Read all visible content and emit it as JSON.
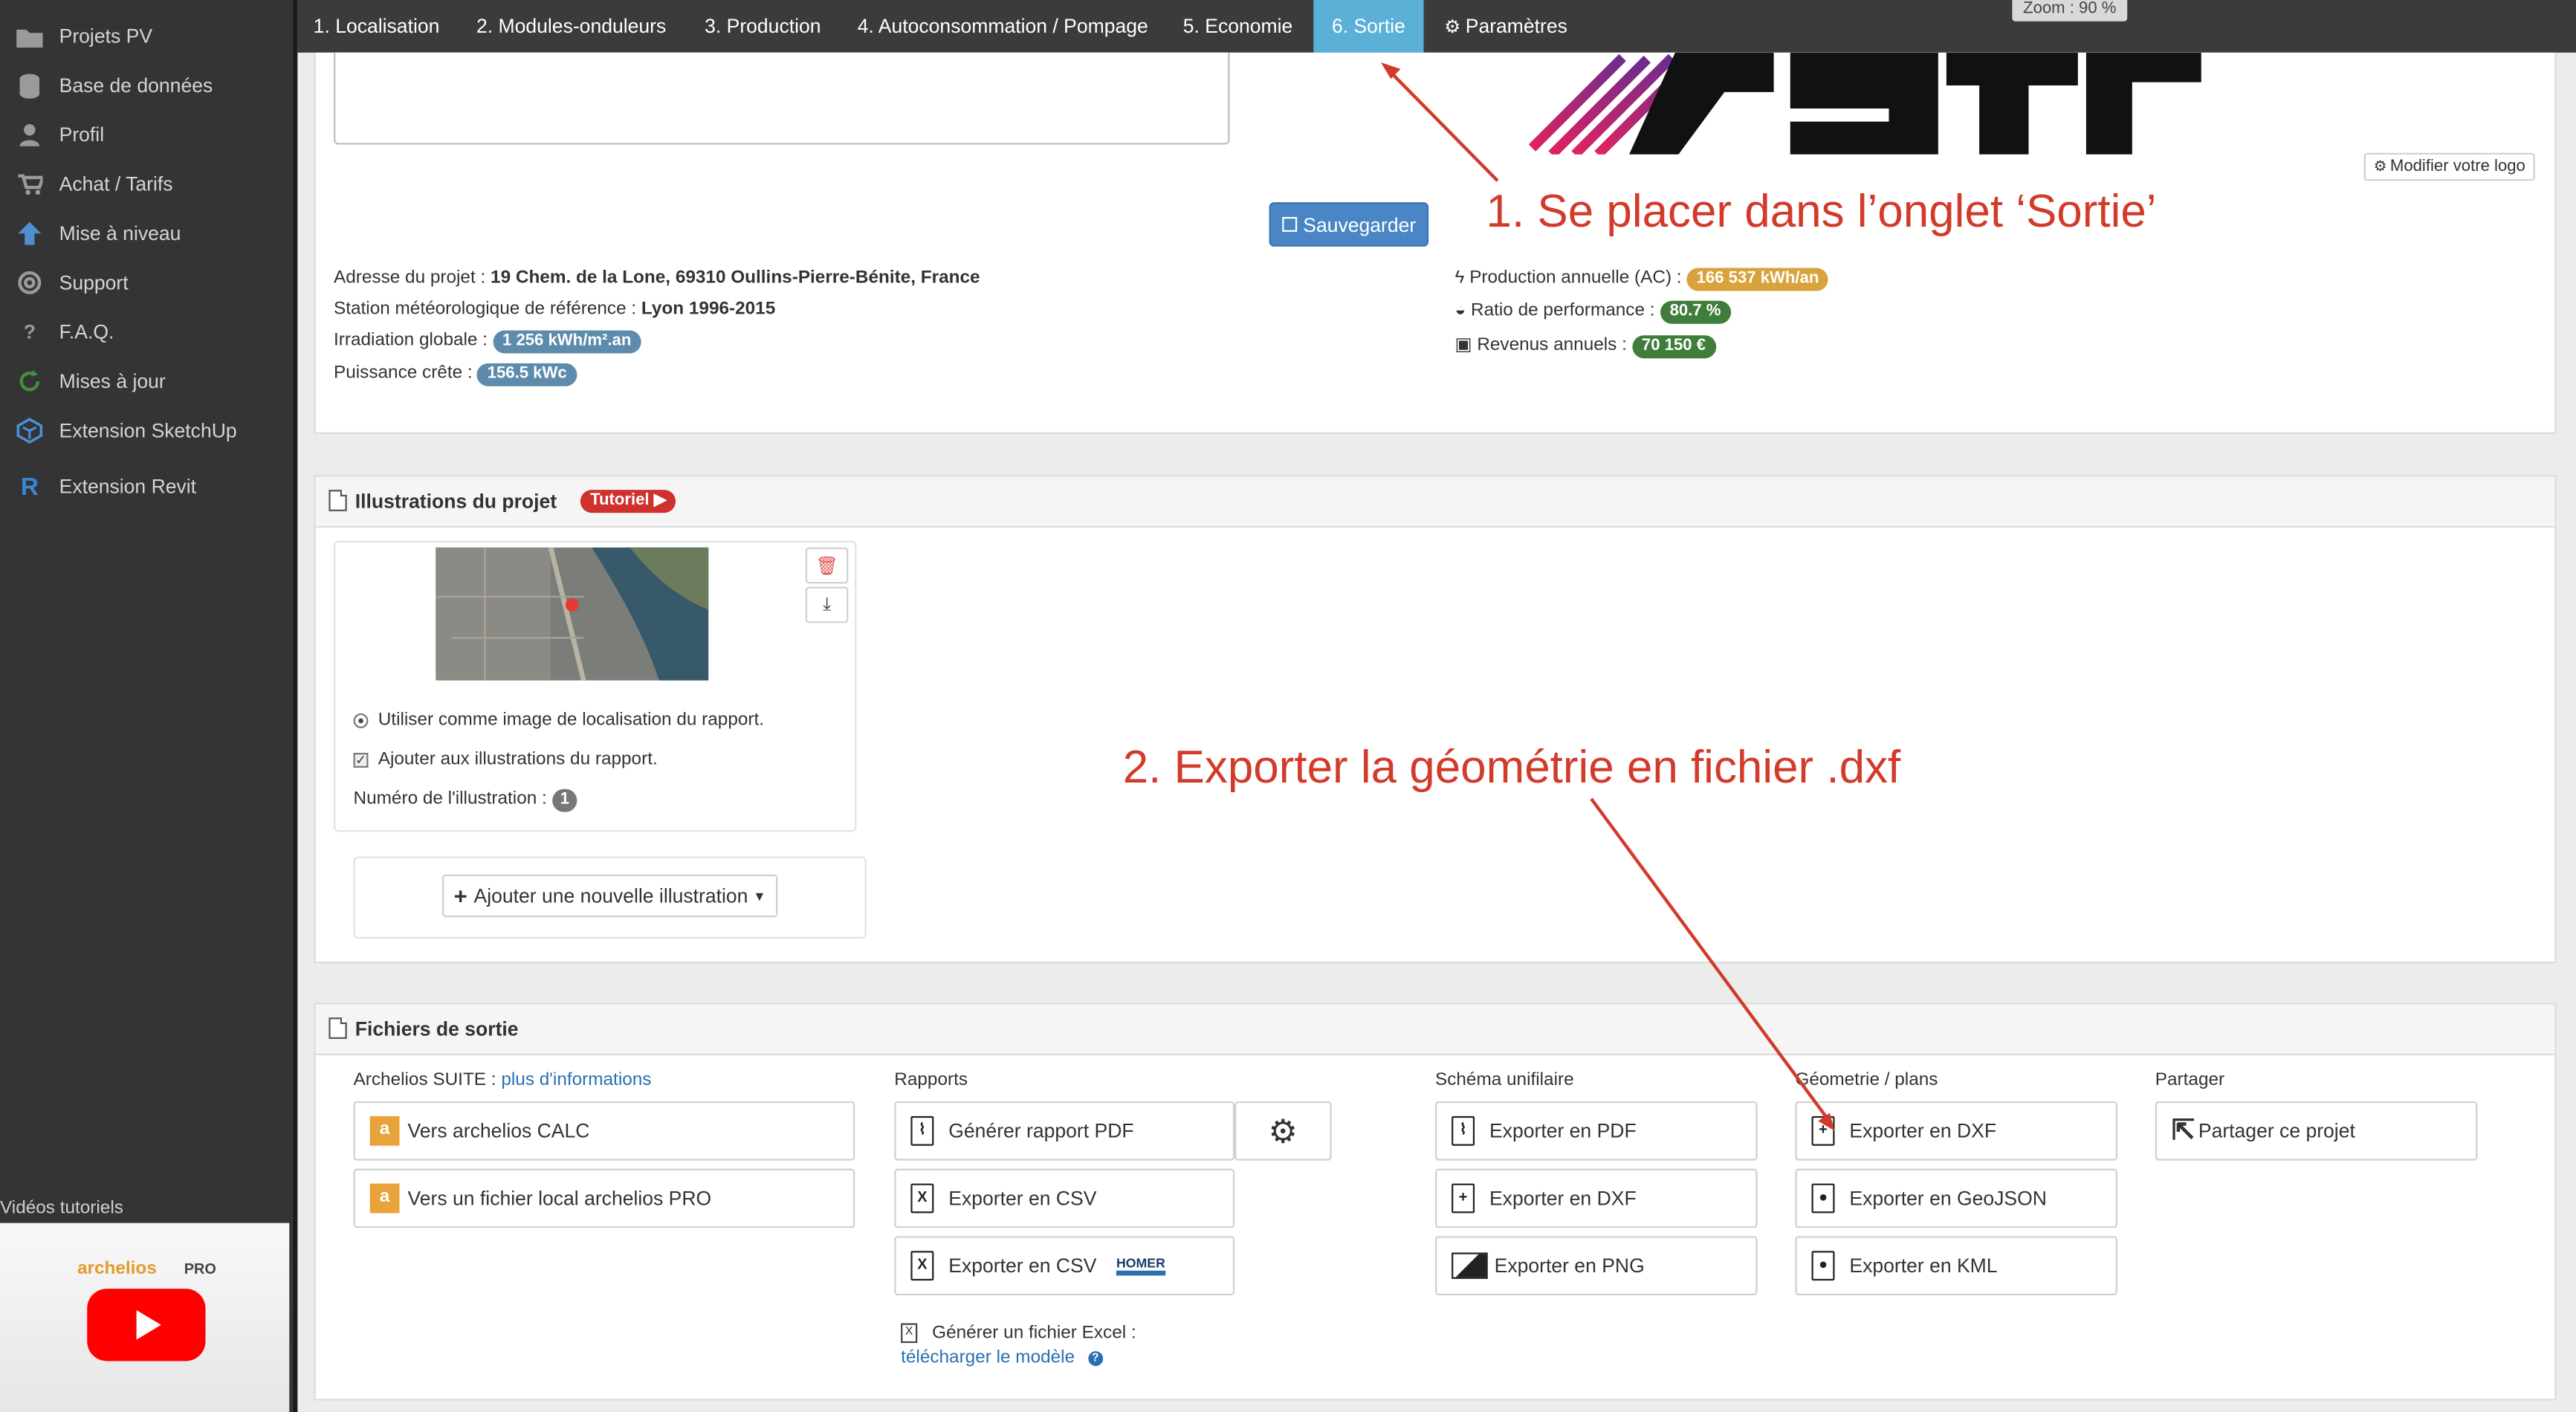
{
  "colors": {
    "accent": "#5ab0d6",
    "sidebar_bg": "#343434",
    "annotation": "#d23a2a",
    "badge_irradiation": "#5d8bab",
    "badge_production": "#d9a23d",
    "badge_green": "#3f7d3a",
    "save_button": "#4a86c5"
  },
  "sidebar": {
    "items": [
      {
        "label": "Projets PV",
        "icon": "folder-icon"
      },
      {
        "label": "Base de données",
        "icon": "database-icon"
      },
      {
        "label": "Profil",
        "icon": "user-icon"
      },
      {
        "label": "Achat / Tarifs",
        "icon": "cart-icon"
      },
      {
        "label": "Mise à niveau",
        "icon": "arrow-up-icon"
      },
      {
        "label": "Support",
        "icon": "lifebuoy-icon"
      },
      {
        "label": "F.A.Q.",
        "icon": "question-icon"
      },
      {
        "label": "Mises à jour",
        "icon": "refresh-icon"
      },
      {
        "label": "Extension SketchUp",
        "icon": "sketchup-icon"
      },
      {
        "label": "Extension Revit",
        "icon": "revit-icon"
      }
    ],
    "videos_title": "Vidéos tutoriels",
    "video_brand": "archelios",
    "video_brand_pro": "PRO"
  },
  "tabs": [
    {
      "label": "1. Localisation"
    },
    {
      "label": "2. Modules-onduleurs"
    },
    {
      "label": "3. Production"
    },
    {
      "label": "4. Autoconsommation / Pompage"
    },
    {
      "label": "5. Economie"
    },
    {
      "label": "6. Sortie",
      "active": true
    },
    {
      "label": "Paramètres",
      "icon": "gears-icon"
    }
  ],
  "zoom_label": "Zoom : 90 %",
  "project": {
    "save_label": "Sauvegarder",
    "modify_logo_label": "Modifier votre logo",
    "address_label": "Adresse du projet :",
    "address_value": "19 Chem. de la Lone, 69310 Oullins-Pierre-Bénite, France",
    "station_label": "Station météorologique de référence :",
    "station_value": "Lyon 1996-2015",
    "irradiation_label": "Irradiation globale :",
    "irradiation_value": "1 256 kWh/m².an",
    "power_label": "Puissance crête :",
    "power_value": "156.5 kWc",
    "production_label": "Production annuelle (AC) :",
    "production_value": "166 537 kWh/an",
    "ratio_label": "Ratio de performance :",
    "ratio_value": "80.7 %",
    "revenue_label": "Revenus annuels :",
    "revenue_value": "70 150 €"
  },
  "illustrations": {
    "title": "Illustrations du projet",
    "tutorial_label": "Tutoriel",
    "use_as_location_label": "Utiliser comme image de localisation du rapport.",
    "add_to_illustrations_label": "Ajouter aux illustrations du rapport.",
    "number_label": "Numéro de l'illustration :",
    "number_value": "1",
    "add_new_label": "Ajouter une nouvelle illustration"
  },
  "outputs": {
    "title": "Fichiers de sortie",
    "suite_label": "Archelios SUITE :",
    "suite_link": "plus d'informations",
    "calc_label": "Vers archelios CALC",
    "pro_label": "Vers un fichier local archelios PRO",
    "reports_title": "Rapports",
    "report_pdf_label": "Générer rapport PDF",
    "csv_label": "Exporter en CSV",
    "csv_homer_label": "Exporter en CSV",
    "homer_logo": "HOMER",
    "excel_label": "Générer un fichier Excel :",
    "excel_link": "télécharger le modèle",
    "schema_title": "Schéma unifilaire",
    "schema_pdf_label": "Exporter en PDF",
    "schema_dxf_label": "Exporter en DXF",
    "schema_png_label": "Exporter en PNG",
    "geometry_title": "Géometrie / plans",
    "geo_dxf_label": "Exporter en DXF",
    "geo_geojson_label": "Exporter en GeoJSON",
    "geo_kml_label": "Exporter en KML",
    "share_title": "Partager",
    "share_label": "Partager ce projet"
  },
  "annotations": {
    "step1": "1. Se placer dans l’onglet ‘Sortie’",
    "step2": "2. Exporter la géométrie en fichier .dxf"
  }
}
